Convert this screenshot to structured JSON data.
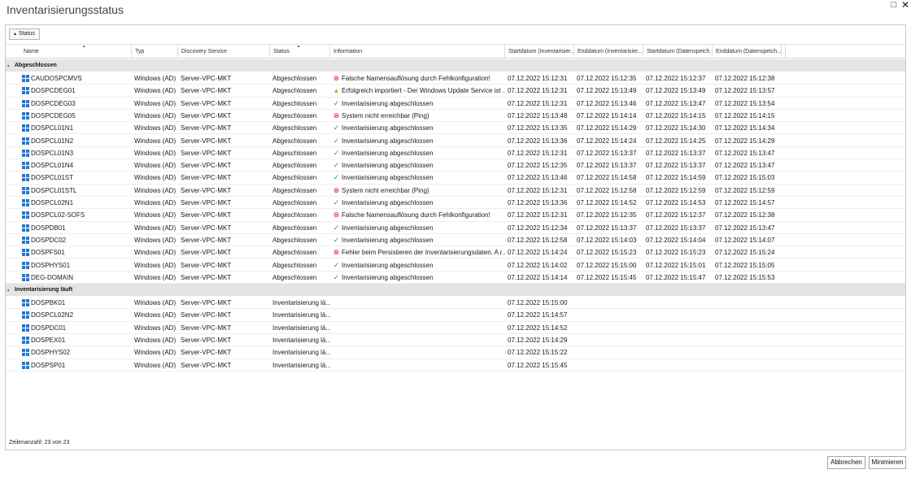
{
  "window": {
    "title": "Inventarisierungsstatus",
    "maximize_glyph": "□",
    "close_glyph": "✕"
  },
  "grouping": {
    "chip_label": "Status"
  },
  "columns": [
    {
      "key": "name",
      "label": "Name"
    },
    {
      "key": "typ",
      "label": "Typ"
    },
    {
      "key": "service",
      "label": "Discovery Service"
    },
    {
      "key": "status",
      "label": "Status"
    },
    {
      "key": "info",
      "label": "Information"
    },
    {
      "key": "start_inv",
      "label": "Startdatum (Inventarisier..."
    },
    {
      "key": "end_inv",
      "label": "Enddatum (Inventarisier..."
    },
    {
      "key": "start_save",
      "label": "Startdatum (Datenspeich..."
    },
    {
      "key": "end_save",
      "label": "Enddatum (Datenspeich..."
    }
  ],
  "groups": [
    {
      "label": "Abgeschlossen",
      "rows": [
        {
          "name": "CAUDOSPCMVS",
          "typ": "Windows (AD)",
          "service": "Server-VPC-MKT",
          "status": "Abgeschlossen",
          "icon": "error",
          "info": "Falsche Namensauflösung durch Fehlkonfiguration!",
          "start_inv": "07.12.2022 15:12:31",
          "end_inv": "07.12.2022 15:12:35",
          "start_save": "07.12.2022 15:12:37",
          "end_save": "07.12.2022 15:12:38"
        },
        {
          "name": "DOSPCDEG01",
          "typ": "Windows (AD)",
          "service": "Server-VPC-MKT",
          "status": "Abgeschlossen",
          "icon": "warning",
          "info": "Erfolgreich importiert - Der Windows Update Service ist ...",
          "start_inv": "07.12.2022 15:12:31",
          "end_inv": "07.12.2022 15:13:49",
          "start_save": "07.12.2022 15:13:49",
          "end_save": "07.12.2022 15:13:57"
        },
        {
          "name": "DOSPCDEG03",
          "typ": "Windows (AD)",
          "service": "Server-VPC-MKT",
          "status": "Abgeschlossen",
          "icon": "ok",
          "info": "Inventarisierung abgeschlossen",
          "start_inv": "07.12.2022 15:12:31",
          "end_inv": "07.12.2022 15:13:46",
          "start_save": "07.12.2022 15:13:47",
          "end_save": "07.12.2022 15:13:54"
        },
        {
          "name": "DOSPCDEG05",
          "typ": "Windows (AD)",
          "service": "Server-VPC-MKT",
          "status": "Abgeschlossen",
          "icon": "error",
          "info": "System nicht erreichbar (Ping)",
          "start_inv": "07.12.2022 15:13:48",
          "end_inv": "07.12.2022 15:14:14",
          "start_save": "07.12.2022 15:14:15",
          "end_save": "07.12.2022 15:14:15"
        },
        {
          "name": "DOSPCL01N1",
          "typ": "Windows (AD)",
          "service": "Server-VPC-MKT",
          "status": "Abgeschlossen",
          "icon": "ok",
          "info": "Inventarisierung abgeschlossen",
          "start_inv": "07.12.2022 15:13:35",
          "end_inv": "07.12.2022 15:14:29",
          "start_save": "07.12.2022 15:14:30",
          "end_save": "07.12.2022 15:14:34"
        },
        {
          "name": "DOSPCL01N2",
          "typ": "Windows (AD)",
          "service": "Server-VPC-MKT",
          "status": "Abgeschlossen",
          "icon": "ok",
          "info": "Inventarisierung abgeschlossen",
          "start_inv": "07.12.2022 15:13:36",
          "end_inv": "07.12.2022 15:14:24",
          "start_save": "07.12.2022 15:14:25",
          "end_save": "07.12.2022 15:14:29"
        },
        {
          "name": "DOSPCL01N3",
          "typ": "Windows (AD)",
          "service": "Server-VPC-MKT",
          "status": "Abgeschlossen",
          "icon": "ok",
          "info": "Inventarisierung abgeschlossen",
          "start_inv": "07.12.2022 15:12:31",
          "end_inv": "07.12.2022 15:13:37",
          "start_save": "07.12.2022 15:13:37",
          "end_save": "07.12.2022 15:13:47"
        },
        {
          "name": "DOSPCL01N4",
          "typ": "Windows (AD)",
          "service": "Server-VPC-MKT",
          "status": "Abgeschlossen",
          "icon": "ok",
          "info": "Inventarisierung abgeschlossen",
          "start_inv": "07.12.2022 15:12:35",
          "end_inv": "07.12.2022 15:13:37",
          "start_save": "07.12.2022 15:13:37",
          "end_save": "07.12.2022 15:13:47"
        },
        {
          "name": "DOSPCL01ST",
          "typ": "Windows (AD)",
          "service": "Server-VPC-MKT",
          "status": "Abgeschlossen",
          "icon": "ok",
          "info": "Inventarisierung abgeschlossen",
          "start_inv": "07.12.2022 15:13:46",
          "end_inv": "07.12.2022 15:14:58",
          "start_save": "07.12.2022 15:14:59",
          "end_save": "07.12.2022 15:15:03"
        },
        {
          "name": "DOSPCL01STL",
          "typ": "Windows (AD)",
          "service": "Server-VPC-MKT",
          "status": "Abgeschlossen",
          "icon": "error",
          "info": "System nicht erreichbar (Ping)",
          "start_inv": "07.12.2022 15:12:31",
          "end_inv": "07.12.2022 15:12:58",
          "start_save": "07.12.2022 15:12:59",
          "end_save": "07.12.2022 15:12:59"
        },
        {
          "name": "DOSPCL02N1",
          "typ": "Windows (AD)",
          "service": "Server-VPC-MKT",
          "status": "Abgeschlossen",
          "icon": "ok",
          "info": "Inventarisierung abgeschlossen",
          "start_inv": "07.12.2022 15:13:36",
          "end_inv": "07.12.2022 15:14:52",
          "start_save": "07.12.2022 15:14:53",
          "end_save": "07.12.2022 15:14:57"
        },
        {
          "name": "DOSPCL02-SOFS",
          "typ": "Windows (AD)",
          "service": "Server-VPC-MKT",
          "status": "Abgeschlossen",
          "icon": "error",
          "info": "Falsche Namensauflösung durch Fehlkonfiguration!",
          "start_inv": "07.12.2022 15:12:31",
          "end_inv": "07.12.2022 15:12:35",
          "start_save": "07.12.2022 15:12:37",
          "end_save": "07.12.2022 15:12:38"
        },
        {
          "name": "DOSPDB01",
          "typ": "Windows (AD)",
          "service": "Server-VPC-MKT",
          "status": "Abgeschlossen",
          "icon": "ok",
          "info": "Inventarisierung abgeschlossen",
          "start_inv": "07.12.2022 15:12:34",
          "end_inv": "07.12.2022 15:13:37",
          "start_save": "07.12.2022 15:13:37",
          "end_save": "07.12.2022 15:13:47"
        },
        {
          "name": "DOSPDC02",
          "typ": "Windows (AD)",
          "service": "Server-VPC-MKT",
          "status": "Abgeschlossen",
          "icon": "ok",
          "info": "Inventarisierung abgeschlossen",
          "start_inv": "07.12.2022 15:12:58",
          "end_inv": "07.12.2022 15:14:03",
          "start_save": "07.12.2022 15:14:04",
          "end_save": "07.12.2022 15:14:07"
        },
        {
          "name": "DOSPFS01",
          "typ": "Windows (AD)",
          "service": "Server-VPC-MKT",
          "status": "Abgeschlossen",
          "icon": "error",
          "info": "Fehler beim Persistieren der Inventarisierungsdaten. A r...",
          "start_inv": "07.12.2022 15:14:24",
          "end_inv": "07.12.2022 15:15:23",
          "start_save": "07.12.2022 15:15:23",
          "end_save": "07.12.2022 15:15:24"
        },
        {
          "name": "DOSPHYS01",
          "typ": "Windows (AD)",
          "service": "Server-VPC-MKT",
          "status": "Abgeschlossen",
          "icon": "ok",
          "info": "Inventarisierung abgeschlossen",
          "start_inv": "07.12.2022 15:14:02",
          "end_inv": "07.12.2022 15:15:00",
          "start_save": "07.12.2022 15:15:01",
          "end_save": "07.12.2022 15:15:05"
        },
        {
          "name": "DEG-DOMAIN",
          "typ": "Windows (AD)",
          "service": "Server-VPC-MKT",
          "status": "Abgeschlossen",
          "icon": "ok",
          "info": "Inventarisierung abgeschlossen",
          "start_inv": "07.12.2022 15:14:14",
          "end_inv": "07.12.2022 15:15:45",
          "start_save": "07.12.2022 15:15:47",
          "end_save": "07.12.2022 15:15:53"
        }
      ]
    },
    {
      "label": "Inventarisierung läuft",
      "rows": [
        {
          "name": "DOSPBK01",
          "typ": "Windows (AD)",
          "service": "Server-VPC-MKT",
          "status": "Inventarisierung lä...",
          "icon": "",
          "info": "",
          "start_inv": "07.12.2022 15:15:00",
          "end_inv": "",
          "start_save": "",
          "end_save": ""
        },
        {
          "name": "DOSPCL02N2",
          "typ": "Windows (AD)",
          "service": "Server-VPC-MKT",
          "status": "Inventarisierung lä...",
          "icon": "",
          "info": "",
          "start_inv": "07.12.2022 15:14:57",
          "end_inv": "",
          "start_save": "",
          "end_save": ""
        },
        {
          "name": "DOSPDC01",
          "typ": "Windows (AD)",
          "service": "Server-VPC-MKT",
          "status": "Inventarisierung lä...",
          "icon": "",
          "info": "",
          "start_inv": "07.12.2022 15:14:52",
          "end_inv": "",
          "start_save": "",
          "end_save": ""
        },
        {
          "name": "DOSPEX01",
          "typ": "Windows (AD)",
          "service": "Server-VPC-MKT",
          "status": "Inventarisierung lä...",
          "icon": "",
          "info": "",
          "start_inv": "07.12.2022 15:14:29",
          "end_inv": "",
          "start_save": "",
          "end_save": ""
        },
        {
          "name": "DOSPHYS02",
          "typ": "Windows (AD)",
          "service": "Server-VPC-MKT",
          "status": "Inventarisierung lä...",
          "icon": "",
          "info": "",
          "start_inv": "07.12.2022 15:15:22",
          "end_inv": "",
          "start_save": "",
          "end_save": ""
        },
        {
          "name": "DOSPSP01",
          "typ": "Windows (AD)",
          "service": "Server-VPC-MKT",
          "status": "Inventarisierung lä...",
          "icon": "",
          "info": "",
          "start_inv": "07.12.2022 15:15:45",
          "end_inv": "",
          "start_save": "",
          "end_save": ""
        }
      ]
    }
  ],
  "footer": {
    "row_count": "Zeilenanzahl: 23 von 23"
  },
  "buttons": {
    "cancel": "Abbrechen",
    "minimize": "Minimieren"
  },
  "icons": {
    "os_icon": "windows-logo-icon",
    "error": "error-circle-icon",
    "warning": "warning-triangle-icon",
    "ok": "checkmark-icon"
  },
  "colors": {
    "windows_blue": "#1e78d6",
    "error_red": "#d42a2a",
    "warning_yellow": "#e0a100",
    "ok_green": "#3c9a3c",
    "group_bg": "#e4e4e4"
  }
}
